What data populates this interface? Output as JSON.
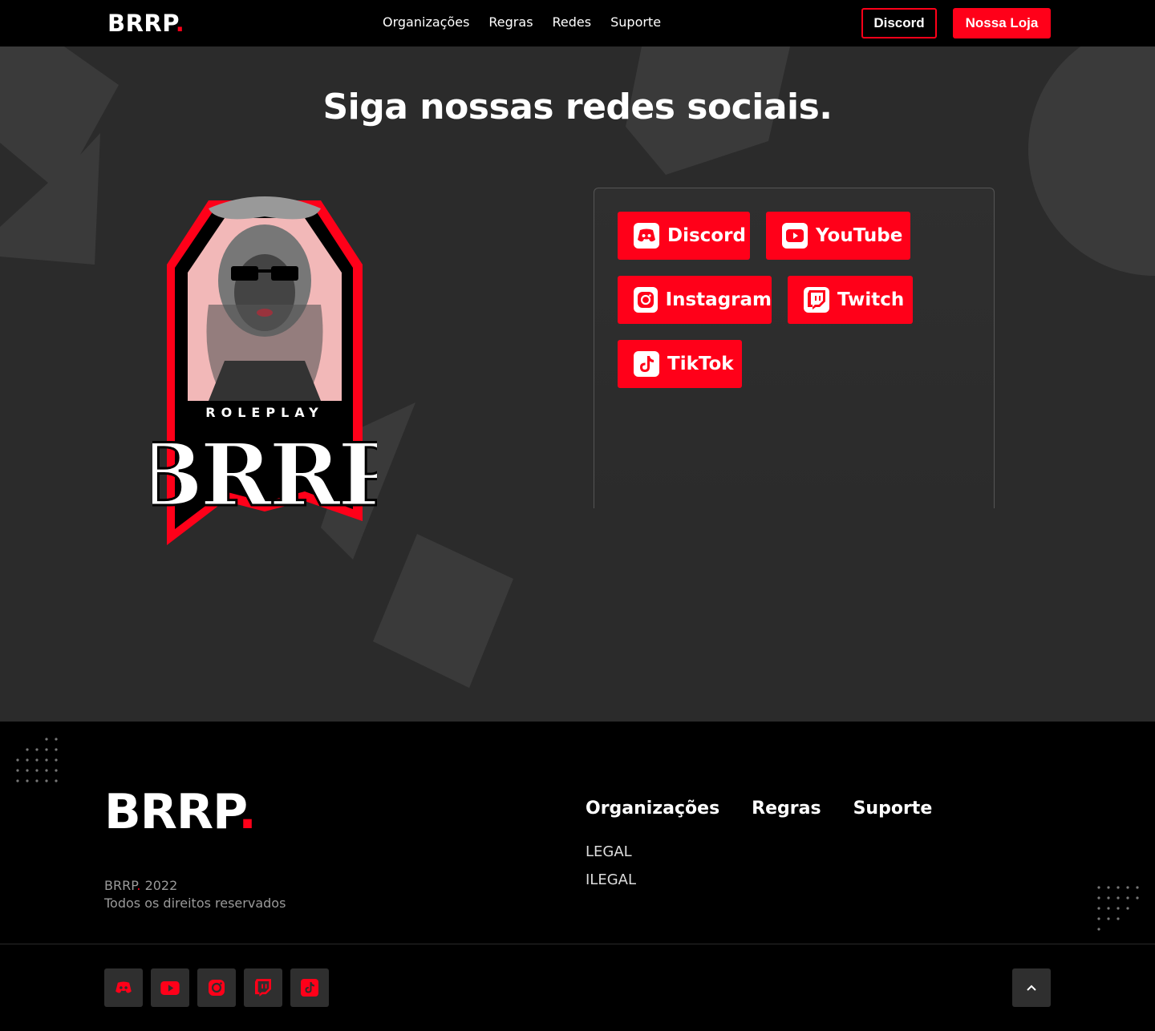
{
  "nav": {
    "logo_text": "BRRP",
    "logo_dot": ".",
    "links": [
      "Organizações",
      "Regras",
      "Redes",
      "Suporte"
    ],
    "discord_label": "Discord",
    "store_label": "Nossa Loja"
  },
  "hero": {
    "title": "Siga nossas redes sociais.",
    "emblem_top_text": "ROLEPLAY",
    "emblem_main_text": "BRRP",
    "social_buttons": [
      {
        "label": "Discord",
        "icon": "discord-icon"
      },
      {
        "label": "YouTube",
        "icon": "youtube-icon"
      },
      {
        "label": "Instagram",
        "icon": "instagram-icon"
      },
      {
        "label": "Twitch",
        "icon": "twitch-icon"
      },
      {
        "label": "TikTok",
        "icon": "tiktok-icon"
      }
    ]
  },
  "footer": {
    "logo_text": "BRRP",
    "logo_dot": ".",
    "copyright_brand": "BRRP",
    "copyright_dot": ".",
    "copyright_year": "2022",
    "rights": "Todos os direitos reservados",
    "columns": [
      "Organizações",
      "Regras",
      "Suporte"
    ],
    "sub_links": [
      "LEGAL",
      "ILEGAL"
    ],
    "social_icons": [
      "discord-icon",
      "youtube-icon",
      "instagram-icon",
      "twitch-icon",
      "tiktok-icon"
    ],
    "back_to_top_icon": "chevron-up-icon"
  },
  "colors": {
    "accent": "#ff0019",
    "hero_bg": "#2b2b2b",
    "nav_bg": "#000000",
    "footer_bg": "#000000"
  }
}
